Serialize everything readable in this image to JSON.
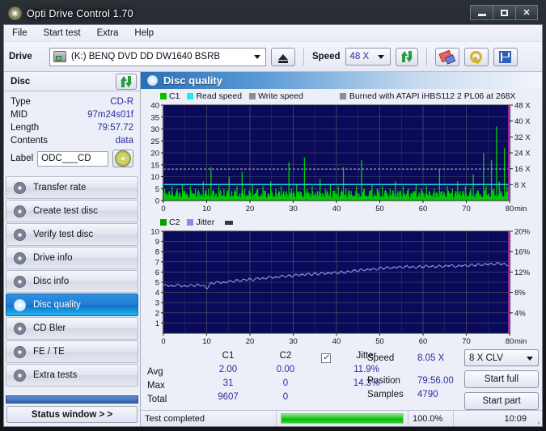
{
  "window": {
    "title": "Opti Drive Control 1.70",
    "icon": "disc-icon",
    "buttons": {
      "minimize": "minimize-icon",
      "maximize": "maximize-icon",
      "close": "close-icon"
    }
  },
  "menu": {
    "items": [
      "File",
      "Start test",
      "Extra",
      "Help"
    ]
  },
  "toolbar": {
    "drive_label": "Drive",
    "drive_value": "(K:)  BENQ DVD DD DW1640 BSRB",
    "eject_icon": "eject-icon",
    "speed_label": "Speed",
    "speed_value": "48 X",
    "refresh_icon": "refresh-icon",
    "erase_icon": "eraser-icon",
    "tools_icon": "wrench-icon",
    "save_icon": "save-icon"
  },
  "disc": {
    "header": "Disc",
    "refresh_icon": "refresh-icon",
    "rows": [
      {
        "key": "Type",
        "value": "CD-R"
      },
      {
        "key": "MID",
        "value": "97m24s01f"
      },
      {
        "key": "Length",
        "value": "79:57.72"
      },
      {
        "key": "Contents",
        "value": "data"
      }
    ],
    "label_key": "Label",
    "label_value": "ODC___CD",
    "label_icon": "cd-icon"
  },
  "nav": {
    "items": [
      {
        "label": "Transfer rate",
        "active": false
      },
      {
        "label": "Create test disc",
        "active": false
      },
      {
        "label": "Verify test disc",
        "active": false
      },
      {
        "label": "Drive info",
        "active": false
      },
      {
        "label": "Disc info",
        "active": false
      },
      {
        "label": "Disc quality",
        "active": true
      },
      {
        "label": "CD Bler",
        "active": false
      },
      {
        "label": "FE / TE",
        "active": false
      },
      {
        "label": "Extra tests",
        "active": false
      }
    ],
    "status_window": "Status window > >"
  },
  "panel": {
    "title": "Disc quality",
    "icon": "disc-quality-icon"
  },
  "stats": {
    "columns": [
      "C1",
      "C2"
    ],
    "jitter_label": "Jitter",
    "jitter_checked": true,
    "rows": [
      {
        "label": "Avg",
        "c1": "2.00",
        "c2": "0.00",
        "jitter": "11.9%"
      },
      {
        "label": "Max",
        "c1": "31",
        "c2": "0",
        "jitter": "14.3%"
      },
      {
        "label": "Total",
        "c1": "9607",
        "c2": "0",
        "jitter": ""
      }
    ],
    "speed_key": "Speed",
    "speed_value": "8.05 X",
    "position_key": "Position",
    "position_value": "79:56.00",
    "samples_key": "Samples",
    "samples_value": "4790",
    "clv_value": "8 X CLV",
    "start_full": "Start full",
    "start_part": "Start part"
  },
  "statusbar": {
    "message": "Test completed",
    "progress_percent": 100.0,
    "progress_text": "100.0%",
    "time": "10:09"
  },
  "chart_data": [
    {
      "type": "line",
      "name": "c1-chart",
      "title": "",
      "xlabel": "min",
      "ylabel": "",
      "xlim": [
        0,
        80
      ],
      "ylim": [
        0,
        40
      ],
      "xticks": [
        0,
        10,
        20,
        30,
        40,
        50,
        60,
        70,
        80
      ],
      "yticks": [
        0,
        5,
        10,
        15,
        20,
        25,
        30,
        35,
        40
      ],
      "y2ticks": [
        8,
        16,
        24,
        32,
        40,
        48
      ],
      "y2labels": [
        "8 X",
        "16 X",
        "24 X",
        "32 X",
        "40 X",
        "48 X"
      ],
      "y2lim": [
        0,
        48
      ],
      "grid": true,
      "legend": [
        {
          "label": "C1",
          "color": "#00d000"
        },
        {
          "label": "Read speed",
          "color": "#22e8f2"
        },
        {
          "label": "Write speed",
          "color": "#9a9a9a"
        },
        {
          "label": "Burned with ATAPI iHBS112   2 PL06 at 268X",
          "color": "#9a9a9a"
        }
      ],
      "plot_bg": "#0a0a5a",
      "series": [
        {
          "name": "C1",
          "color": "#00d000",
          "kind": "impulse",
          "x": [
            0.3,
            0.8,
            1.4,
            2,
            2.6,
            3.2,
            3.8,
            4.4,
            5,
            5.6,
            6.2,
            6.8,
            7.4,
            8,
            8.6,
            9.2,
            9.8,
            10.4,
            11,
            11.6,
            12.2,
            12.8,
            13.4,
            14,
            14.6,
            15.2,
            15.8,
            16.4,
            17,
            17.6,
            18.2,
            18.8,
            19.4,
            20,
            20.6,
            21.2,
            21.8,
            22.4,
            23,
            23.6,
            24.2,
            24.8,
            25.4,
            26,
            26.6,
            27.2,
            27.8,
            28.4,
            29,
            29.6,
            30.2,
            30.8,
            31.4,
            32,
            32.6,
            33.2,
            33.8,
            34.4,
            35,
            35.6,
            36.2,
            36.8,
            37.4,
            38,
            38.6,
            39.2,
            39.8,
            40.4,
            41,
            41.6,
            42.2,
            42.8,
            43.4,
            44,
            44.6,
            45.2,
            45.8,
            46.4,
            47,
            47.6,
            48.2,
            48.8,
            49.4,
            50,
            50.6,
            51.2,
            51.8,
            52.4,
            53,
            53.6,
            54.2,
            54.8,
            55.4,
            56,
            56.6,
            57.2,
            57.8,
            58.4,
            59,
            59.6,
            60.2,
            60.8,
            61.4,
            62,
            62.6,
            63.2,
            63.8,
            64.4,
            65,
            65.6,
            66.2,
            66.8,
            67.4,
            68,
            68.6,
            69.2,
            69.8,
            70.4,
            71,
            71.6,
            72.2,
            72.8,
            73.4,
            74,
            74.6,
            75.2,
            75.8,
            76.4,
            77,
            77.6,
            78.2,
            78.8,
            79.4,
            79.9
          ],
          "y": [
            5,
            3,
            4,
            6,
            2,
            5,
            3,
            7,
            4,
            2,
            6,
            3,
            5,
            4,
            2,
            8,
            3,
            5,
            14,
            4,
            3,
            6,
            2,
            5,
            3,
            10,
            4,
            2,
            6,
            3,
            12,
            5,
            2,
            4,
            7,
            3,
            5,
            2,
            6,
            4,
            3,
            8,
            2,
            5,
            3,
            6,
            4,
            2,
            16,
            5,
            3,
            7,
            4,
            2,
            18,
            5,
            3,
            6,
            2,
            4,
            9,
            3,
            5,
            2,
            7,
            4,
            3,
            6,
            2,
            14,
            5,
            3,
            4,
            2,
            6,
            3,
            17,
            5,
            2,
            4,
            7,
            3,
            5,
            2,
            6,
            4,
            3,
            5,
            2,
            8,
            4,
            3,
            6,
            2,
            5,
            3,
            4,
            7,
            2,
            5,
            3,
            6,
            4,
            2,
            5,
            3,
            13,
            4,
            2,
            6,
            3,
            5,
            2,
            8,
            4,
            3,
            6,
            2,
            5,
            11,
            3,
            4,
            2,
            20,
            6,
            3,
            17,
            5,
            31,
            8,
            4,
            22,
            6,
            3,
            28,
            5,
            2
          ]
        },
        {
          "name": "Read speed",
          "color": "#22e8f2",
          "kind": "line",
          "constant_y2": 8.05
        },
        {
          "name": "Write speed",
          "color": "#a8a8c0",
          "kind": "dashed",
          "constant": 13.2
        }
      ]
    },
    {
      "type": "line",
      "name": "jitter-chart",
      "xlabel": "min",
      "xlim": [
        0,
        80
      ],
      "ylim": [
        0,
        10
      ],
      "xticks": [
        0,
        10,
        20,
        30,
        40,
        50,
        60,
        70,
        80
      ],
      "yticks": [
        1,
        2,
        3,
        4,
        5,
        6,
        7,
        8,
        9,
        10
      ],
      "y2ticks": [
        4,
        8,
        12,
        16,
        20
      ],
      "y2labels": [
        "4%",
        "8%",
        "12%",
        "16%",
        "20%"
      ],
      "y2lim": [
        0,
        20
      ],
      "grid": true,
      "plot_bg": "#0a0a5a",
      "legend": [
        {
          "label": "C2",
          "color": "#00a000"
        },
        {
          "label": "Jitter",
          "color": "#8a8ae8"
        }
      ],
      "series": [
        {
          "name": "Jitter",
          "color": "#9a9aee",
          "kind": "line",
          "unit": "%",
          "x": [
            0,
            1,
            2,
            3,
            4,
            5,
            6,
            7,
            8,
            9,
            10,
            11,
            12,
            13,
            14,
            15,
            16,
            17,
            18,
            19,
            20,
            21,
            22,
            23,
            24,
            25,
            26,
            27,
            28,
            29,
            30,
            31,
            32,
            33,
            34,
            35,
            36,
            37,
            38,
            39,
            40,
            41,
            42,
            43,
            44,
            45,
            46,
            47,
            48,
            49,
            50,
            51,
            52,
            53,
            54,
            55,
            56,
            57,
            58,
            59,
            60,
            61,
            62,
            63,
            64,
            65,
            66,
            67,
            68,
            69,
            70,
            71,
            72,
            73,
            74,
            75,
            76,
            77,
            78,
            79,
            80
          ],
          "y": [
            9.3,
            9.4,
            9.2,
            9.5,
            9.3,
            9.2,
            9.4,
            9.3,
            9.5,
            9.4,
            8.8,
            9.8,
            9.9,
            10.0,
            9.9,
            10.2,
            10.1,
            10.4,
            10.3,
            10.5,
            10.6,
            10.5,
            10.8,
            10.7,
            10.9,
            11.0,
            10.9,
            11.2,
            11.1,
            11.3,
            11.2,
            11.5,
            11.4,
            11.6,
            11.5,
            11.7,
            11.6,
            11.8,
            11.7,
            11.9,
            11.8,
            12.0,
            11.9,
            12.1,
            12.3,
            12.2,
            12.5,
            12.4,
            12.6,
            12.5,
            12.8,
            12.7,
            12.9,
            12.8,
            13.0,
            12.9,
            13.1,
            13.0,
            12.9,
            13.1,
            13.0,
            13.2,
            13.1,
            13.0,
            13.2,
            13.1,
            13.3,
            13.2,
            13.1,
            13.3,
            13.2,
            13.4,
            13.3,
            13.5,
            13.4,
            13.6,
            13.5,
            13.7,
            13.6,
            13.5,
            13.4
          ]
        },
        {
          "name": "C2",
          "color": "#00a000",
          "kind": "impulse",
          "x": [],
          "y": []
        }
      ]
    }
  ]
}
